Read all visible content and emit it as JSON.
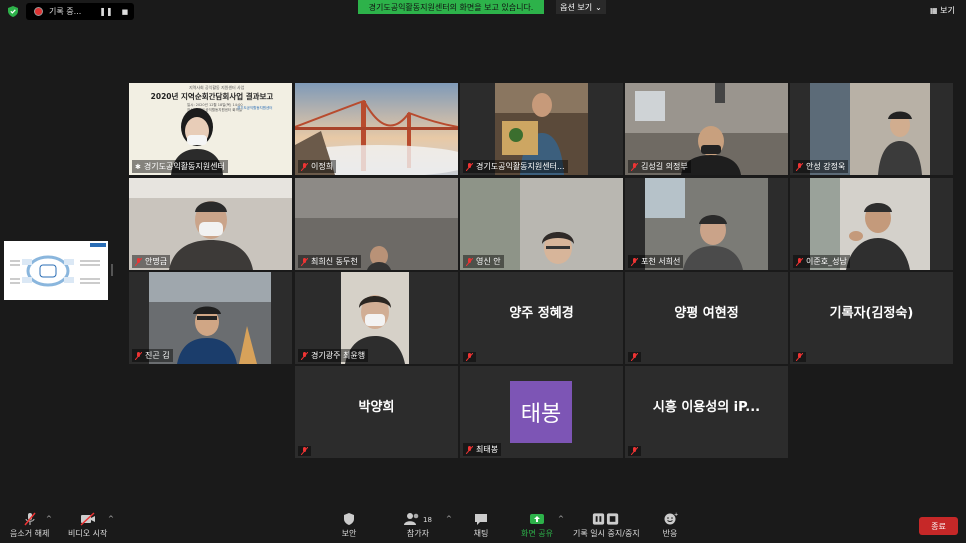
{
  "top": {
    "recording_label": "기록 중...",
    "banner_text": "경기도공익활동지원센터의 화면을 보고 있습니다.",
    "view_options": "옵션 보기",
    "gallery_label": "보기"
  },
  "slide": {
    "tag": "지역사회 공익활동 지원센터 사업",
    "title": "2020년 지역순회간담회사업 결과보고",
    "date_line": "일시: 2020년 12월 18일(목) 14:00",
    "place_line": "장소: 경기도공익활동지원센터 회의실",
    "org": "경기도공익활동지원센터"
  },
  "tiles": [
    {
      "name": "경기도공익활동지원센터",
      "big": "",
      "muted": false
    },
    {
      "name": "이정희",
      "big": "",
      "muted": true
    },
    {
      "name": "경기도공익활동지원센터...",
      "big": "",
      "muted": true
    },
    {
      "name": "김성길 의정부",
      "big": "",
      "muted": true
    },
    {
      "name": "안성 강정욱",
      "big": "",
      "muted": true
    },
    {
      "name": "안명금",
      "big": "",
      "muted": true
    },
    {
      "name": "최희신 동두천",
      "big": "",
      "muted": true
    },
    {
      "name": "영신 안",
      "big": "",
      "muted": true
    },
    {
      "name": "포천 서희선",
      "big": "",
      "muted": true
    },
    {
      "name": "이준호_성남",
      "big": "",
      "muted": true
    },
    {
      "name": "진곤 김",
      "big": "",
      "muted": true
    },
    {
      "name": "경기광주 최윤행",
      "big": "",
      "muted": true
    },
    {
      "name": "",
      "big": "양주 정혜경",
      "muted": true
    },
    {
      "name": "",
      "big": "양평 여현정",
      "muted": true
    },
    {
      "name": "",
      "big": "기록자(김정숙)",
      "muted": true
    },
    {
      "name": "",
      "big": "박양희",
      "muted": true
    },
    {
      "name": "최태봉",
      "big": "",
      "muted": true,
      "avatar": "태봉"
    },
    {
      "name": "",
      "big": "시흥 이용성의 iP...",
      "muted": true
    }
  ],
  "toolbar": {
    "mute": "음소거 해제",
    "video": "비디오 시작",
    "security": "보안",
    "participants": "참가자",
    "participants_count": "18",
    "chat": "채팅",
    "share": "화면 공유",
    "pause_rec": "기록 일시 중지/중지",
    "reactions": "반응",
    "end": "종료"
  },
  "colors": {
    "active_border": "#c8e86a",
    "banner": "#2db24a",
    "share": "#2db24a",
    "end": "#c62828",
    "avatar": "#7d55b5"
  }
}
